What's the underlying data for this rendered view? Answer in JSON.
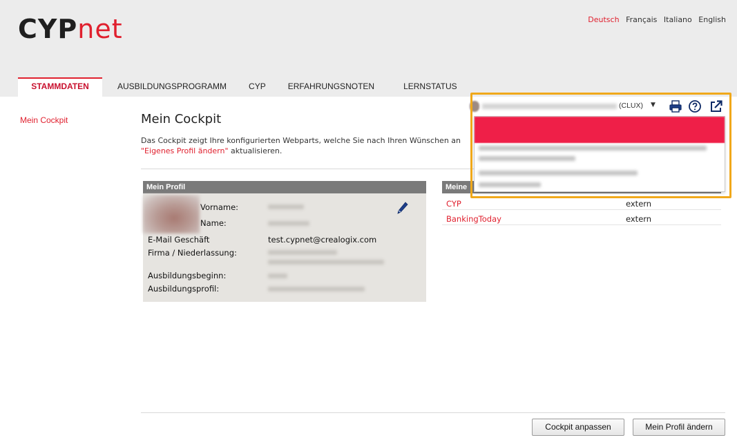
{
  "app": {
    "logo_part1": "CYP",
    "logo_part2": "net"
  },
  "languages": [
    {
      "label": "Deutsch",
      "active": true
    },
    {
      "label": "Français",
      "active": false
    },
    {
      "label": "Italiano",
      "active": false
    },
    {
      "label": "English",
      "active": false
    }
  ],
  "tabs": [
    {
      "label": "STAMMDATEN",
      "active": true
    },
    {
      "label": "AUSBILDUNGSPROGRAMM",
      "active": false
    },
    {
      "label": "CYP",
      "active": false
    },
    {
      "label": "ERFAHRUNGSNOTEN",
      "active": false
    },
    {
      "label": "LERNSTATUS",
      "active": false
    }
  ],
  "sidebar": {
    "items": [
      {
        "label": "Mein Cockpit"
      }
    ]
  },
  "main": {
    "title": "Mein Cockpit",
    "intro_text": "Das Cockpit zeigt Ihre konfigurierten Webparts, welche Sie nach Ihren Wünschen an",
    "intro_link": "\"Eigenes Profil ändern\"",
    "intro_suffix": " aktualisieren."
  },
  "profile": {
    "header": "Mein Profil",
    "labels": {
      "firstname": "Vorname:",
      "lastname": "Name:",
      "email": "E-Mail Geschäft",
      "company": "Firma / Niederlassung:",
      "start": "Ausbildungsbeginn:",
      "profile": "Ausbildungsprofil:"
    },
    "email_value": "test.cypnet@crealogix.com",
    "edit_icon": "pencil-icon"
  },
  "links": {
    "header": "Meine",
    "rows": [
      {
        "name": "CYP",
        "type": "extern"
      },
      {
        "name": "BankingToday",
        "type": "extern"
      }
    ]
  },
  "userbar": {
    "org": "(CLUX)",
    "caret": "▼"
  },
  "toolbar_icons": [
    "printer-icon",
    "help-icon",
    "external-link-icon"
  ],
  "buttons": {
    "customize": "Cockpit anpassen",
    "edit_profile": "Mein Profil ändern"
  },
  "colors": {
    "brand_red": "#e0202e",
    "highlight": "#f0a81a",
    "panel_header": "#7a7a7a",
    "panel_bg": "#e6e4e0"
  }
}
